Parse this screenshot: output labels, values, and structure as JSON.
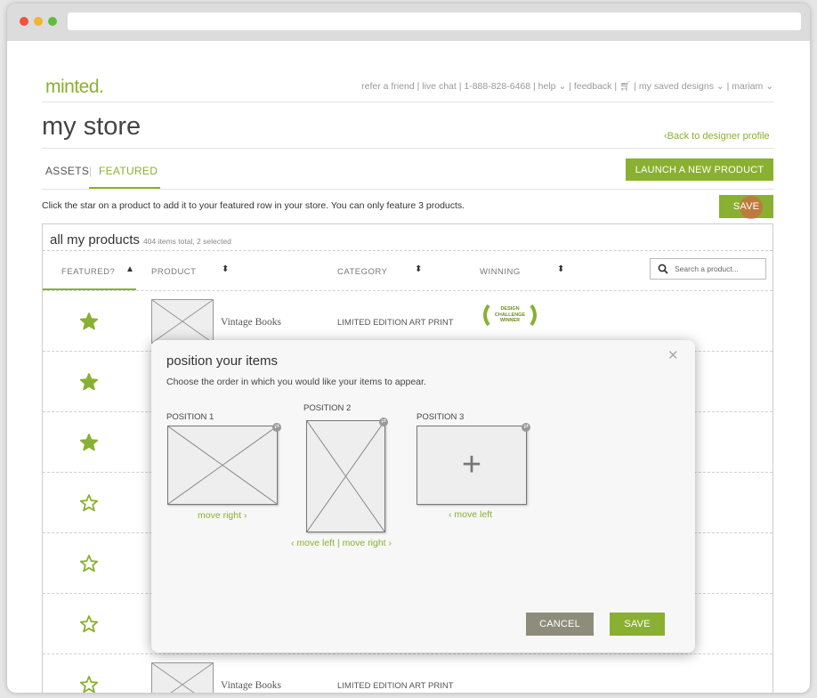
{
  "nav": {
    "logo": "minted.",
    "refer": "refer a friend",
    "chat": "live chat",
    "phone": "1-888-828-6468",
    "help": "help",
    "feedback": "feedback",
    "saved": "my saved designs",
    "user": "mariam"
  },
  "page": {
    "title": "my store",
    "back": "Back to designer profile",
    "tabs": [
      "ASSETS",
      "FEATURED"
    ],
    "launch": "LAUNCH A NEW PRODUCT",
    "info": "Click the star on a product to add it to your featured row in your store. You can only feature 3 products.",
    "save": "SAVE"
  },
  "table": {
    "title": "all my products",
    "subtitle": "404 items total, 2 selected",
    "columns": [
      "FEATURED?",
      "PRODUCT",
      "CATEGORY",
      "WINNING"
    ],
    "search_placeholder": "Search a product...",
    "badge": [
      "DESIGN",
      "CHALLENGE",
      "WINNER"
    ],
    "rows": [
      {
        "featured": true,
        "name": "Vintage Books",
        "category": "LIMITED EDITION ART PRINT"
      },
      {
        "featured": true,
        "name": "",
        "category": ""
      },
      {
        "featured": true,
        "name": "",
        "category": ""
      },
      {
        "featured": false,
        "name": "",
        "category": ""
      },
      {
        "featured": false,
        "name": "",
        "category": ""
      },
      {
        "featured": false,
        "name": "",
        "category": ""
      },
      {
        "featured": false,
        "name": "Vintage Books",
        "category": "LIMITED EDITION ART PRINT"
      }
    ]
  },
  "modal": {
    "title": "position your items",
    "subtitle": "Choose the order in which you would like your items to appear.",
    "positions": [
      "POSITION 1",
      "POSITION 2",
      "POSITION 3"
    ],
    "move1": "move right",
    "move2": "move left | move right",
    "move3": "move left",
    "cancel": "CANCEL",
    "save": "SAVE"
  },
  "colors": {
    "accent": "#8ab031",
    "cancel": "#8e8d7b"
  }
}
